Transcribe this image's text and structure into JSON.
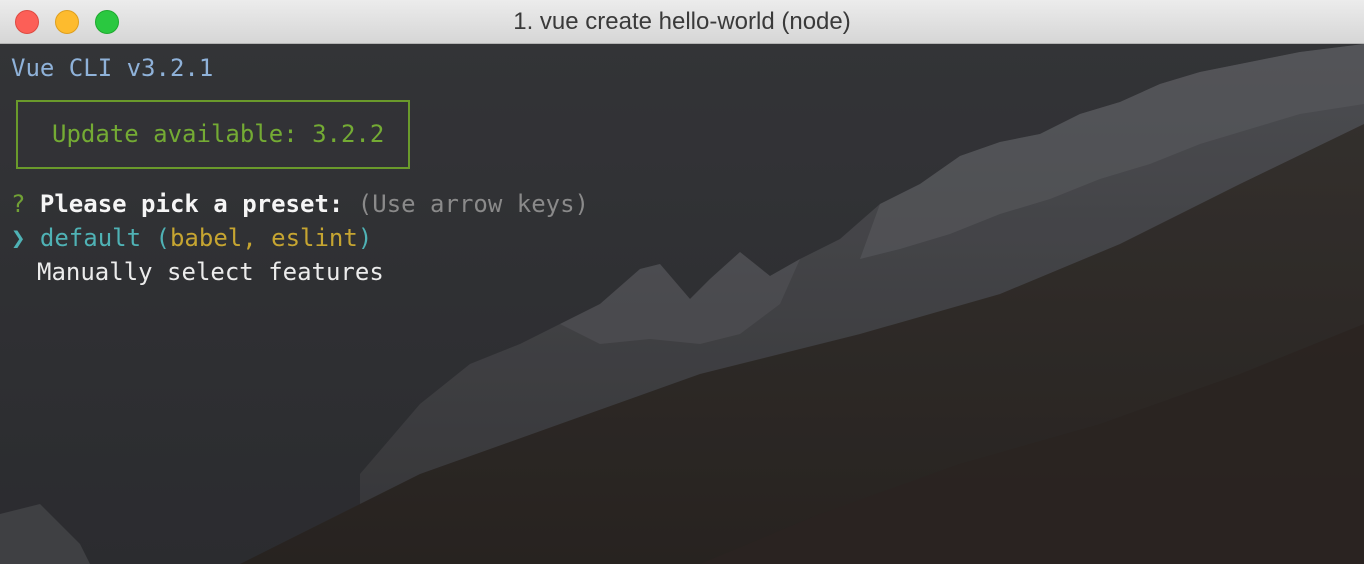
{
  "window": {
    "title": "1. vue create hello-world (node)"
  },
  "terminal": {
    "cli_version": "Vue CLI v3.2.1",
    "update_notice": "Update available: 3.2.2",
    "prompt": {
      "marker": "?",
      "question": "Please pick a preset:",
      "hint": "(Use arrow keys)"
    },
    "options": [
      {
        "pointer": "❯",
        "label": "default",
        "paren_open": " (",
        "detail": "babel, eslint",
        "paren_close": ")",
        "selected": true
      },
      {
        "label": "Manually select features",
        "selected": false
      }
    ]
  },
  "colors": {
    "cli_version": "#8fb2d9",
    "update_border": "#6a9a2b",
    "update_text": "#74ab34",
    "question_mark": "#71a135",
    "selected_option": "#4fb2b5",
    "preset_detail": "#c6a531",
    "hint": "#8a8a8a"
  },
  "icons": {
    "close": "close-icon",
    "minimize": "minimize-icon",
    "zoom": "zoom-icon",
    "pointer": "chevron-right-icon"
  }
}
